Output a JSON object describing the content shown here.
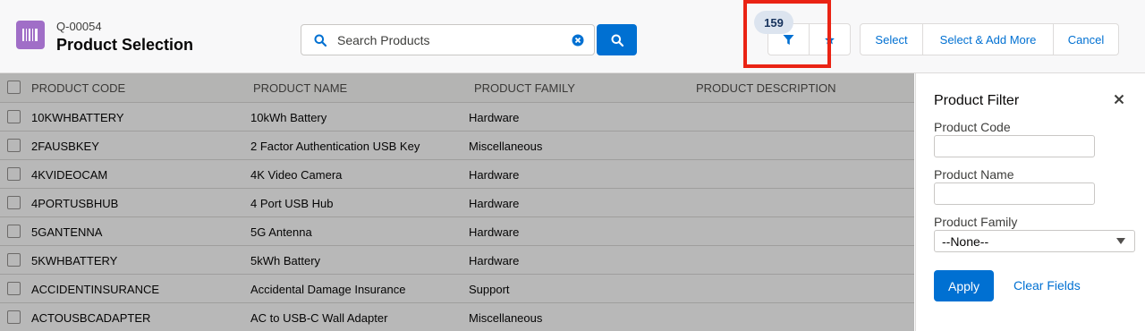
{
  "header": {
    "quote_number": "Q-00054",
    "title": "Product Selection",
    "app_icon": "barcode-icon",
    "icon_color": "#a06ec7"
  },
  "search": {
    "placeholder": "Search Products",
    "value": ""
  },
  "filter": {
    "count": "159",
    "filter_icon": "funnel-icon",
    "favorite_icon": "star-icon"
  },
  "actions": {
    "select": "Select",
    "select_add_more": "Select & Add More",
    "cancel": "Cancel"
  },
  "table": {
    "columns": [
      "PRODUCT CODE",
      "PRODUCT NAME",
      "PRODUCT FAMILY",
      "PRODUCT DESCRIPTION"
    ],
    "rows": [
      {
        "code": "10KWHBATTERY",
        "name": "10kWh Battery",
        "family": "Hardware",
        "description": ""
      },
      {
        "code": "2FAUSBKEY",
        "name": "2 Factor Authentication USB Key",
        "family": "Miscellaneous",
        "description": ""
      },
      {
        "code": "4KVIDEOCAM",
        "name": "4K Video Camera",
        "family": "Hardware",
        "description": ""
      },
      {
        "code": "4PORTUSBHUB",
        "name": "4 Port USB Hub",
        "family": "Hardware",
        "description": ""
      },
      {
        "code": "5GANTENNA",
        "name": "5G Antenna",
        "family": "Hardware",
        "description": ""
      },
      {
        "code": "5KWHBATTERY",
        "name": "5kWh Battery",
        "family": "Hardware",
        "description": ""
      },
      {
        "code": "ACCIDENTINSURANCE",
        "name": "Accidental Damage Insurance",
        "family": "Support",
        "description": ""
      },
      {
        "code": "ACTOUSBCADAPTER",
        "name": "AC to USB-C Wall Adapter",
        "family": "Miscellaneous",
        "description": ""
      }
    ]
  },
  "panel": {
    "title": "Product Filter",
    "close_icon": "close-icon",
    "fields": {
      "product_code_label": "Product Code",
      "product_code_value": "",
      "product_name_label": "Product Name",
      "product_name_value": "",
      "product_family_label": "Product Family",
      "product_family_value": "--None--"
    },
    "apply": "Apply",
    "clear": "Clear Fields"
  },
  "colors": {
    "brand": "#0070d2",
    "highlight": "#ea2314"
  }
}
